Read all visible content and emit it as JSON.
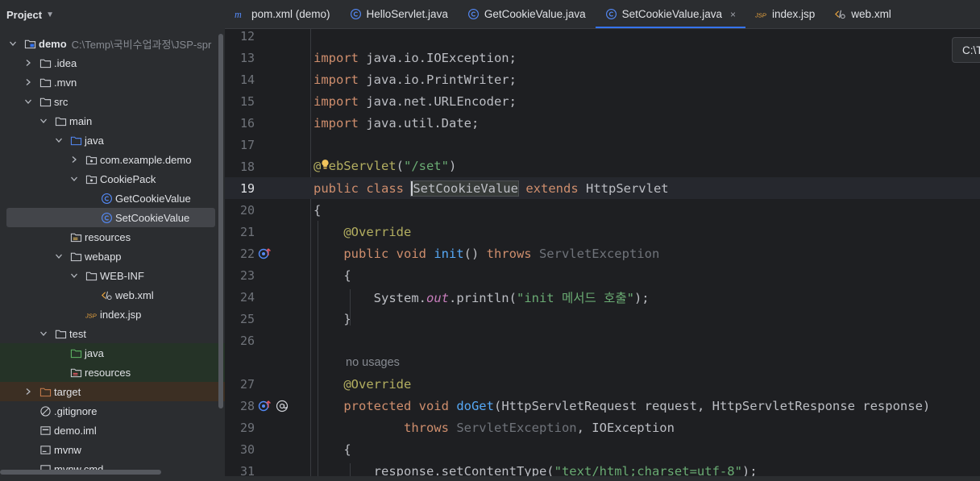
{
  "project_panel": {
    "title": "Project",
    "tree": [
      {
        "label": "demo",
        "hint": "C:\\Temp\\국비수업과정\\JSP-spr",
        "depth": 0,
        "expanded": true,
        "icon": "module-folder-icon",
        "bold": true
      },
      {
        "label": ".idea",
        "depth": 1,
        "expanded": false,
        "icon": "folder-icon"
      },
      {
        "label": ".mvn",
        "depth": 1,
        "expanded": false,
        "icon": "folder-icon"
      },
      {
        "label": "src",
        "depth": 1,
        "expanded": true,
        "icon": "folder-icon"
      },
      {
        "label": "main",
        "depth": 2,
        "expanded": true,
        "icon": "folder-icon"
      },
      {
        "label": "java",
        "depth": 3,
        "expanded": true,
        "icon": "source-folder-icon"
      },
      {
        "label": "com.example.demo",
        "depth": 4,
        "expanded": false,
        "icon": "package-icon"
      },
      {
        "label": "CookiePack",
        "depth": 4,
        "expanded": true,
        "icon": "package-icon"
      },
      {
        "label": "GetCookieValue",
        "depth": 5,
        "icon": "class-icon"
      },
      {
        "label": "SetCookieValue",
        "depth": 5,
        "icon": "class-icon",
        "selected": true
      },
      {
        "label": "resources",
        "depth": 3,
        "icon": "resources-folder-icon"
      },
      {
        "label": "webapp",
        "depth": 3,
        "expanded": true,
        "icon": "folder-icon"
      },
      {
        "label": "WEB-INF",
        "depth": 4,
        "expanded": true,
        "icon": "folder-icon"
      },
      {
        "label": "web.xml",
        "depth": 5,
        "icon": "xml-file-icon"
      },
      {
        "label": "index.jsp",
        "depth": 4,
        "icon": "jsp-file-icon"
      },
      {
        "label": "test",
        "depth": 2,
        "expanded": true,
        "icon": "folder-icon"
      },
      {
        "label": "java",
        "depth": 3,
        "icon": "test-folder-icon",
        "variant": "test"
      },
      {
        "label": "resources",
        "depth": 3,
        "icon": "test-resources-folder-icon",
        "variant": "test"
      },
      {
        "label": "target",
        "depth": 1,
        "expanded": false,
        "icon": "excluded-folder-icon",
        "variant": "excluded"
      },
      {
        "label": ".gitignore",
        "depth": 1,
        "icon": "gitignore-file-icon"
      },
      {
        "label": "demo.iml",
        "depth": 1,
        "icon": "iml-file-icon"
      },
      {
        "label": "mvnw",
        "depth": 1,
        "icon": "script-file-icon"
      },
      {
        "label": "mvnw.cmd",
        "depth": 1,
        "icon": "script-file-icon"
      }
    ]
  },
  "tabs": [
    {
      "label": "pom.xml (demo)",
      "icon": "maven-icon"
    },
    {
      "label": "HelloServlet.java",
      "icon": "class-icon"
    },
    {
      "label": "GetCookieValue.java",
      "icon": "class-icon"
    },
    {
      "label": "SetCookieValue.java",
      "icon": "class-icon",
      "active": true,
      "close": "×"
    },
    {
      "label": "index.jsp",
      "icon": "jsp-file-icon"
    },
    {
      "label": "web.xml",
      "icon": "xml-file-icon"
    }
  ],
  "tooltip": "C:\\T",
  "editor": {
    "lines": [
      {
        "n": "12",
        "tokens": []
      },
      {
        "n": "13",
        "tokens": [
          [
            "kw",
            "import"
          ],
          [
            "t",
            " java.io.IOException;"
          ]
        ]
      },
      {
        "n": "14",
        "tokens": [
          [
            "kw",
            "import"
          ],
          [
            "t",
            " java.io.PrintWriter;"
          ]
        ]
      },
      {
        "n": "15",
        "tokens": [
          [
            "kw",
            "import"
          ],
          [
            "t",
            " java.net.URLEncoder;"
          ]
        ]
      },
      {
        "n": "16",
        "tokens": [
          [
            "kw",
            "import"
          ],
          [
            "t",
            " java.util.Date;"
          ]
        ]
      },
      {
        "n": "17",
        "tokens": []
      },
      {
        "n": "18",
        "tokens": [
          [
            "ann",
            "@"
          ],
          [
            "bulb",
            ""
          ],
          [
            "ann",
            "ebServlet"
          ],
          [
            "t",
            "("
          ],
          [
            "str",
            "\"/set\""
          ],
          [
            "t",
            ")"
          ]
        ]
      },
      {
        "n": "19",
        "current": true,
        "tokens": [
          [
            "kw",
            "public class "
          ],
          [
            "hl",
            "SetCookieValue"
          ],
          [
            "t",
            " "
          ],
          [
            "kw",
            "extends"
          ],
          [
            "t",
            " HttpServlet"
          ]
        ]
      },
      {
        "n": "20",
        "tokens": [
          [
            "t",
            "{"
          ]
        ]
      },
      {
        "n": "21",
        "tokens": [
          [
            "t",
            "    "
          ],
          [
            "ann",
            "@Override"
          ]
        ]
      },
      {
        "n": "22",
        "gutter": [
          "override-icon"
        ],
        "tokens": [
          [
            "t",
            "    "
          ],
          [
            "kw",
            "public void "
          ],
          [
            "fn",
            "init"
          ],
          [
            "t",
            "() "
          ],
          [
            "kw",
            "throws "
          ],
          [
            "gray",
            "ServletException"
          ]
        ]
      },
      {
        "n": "23",
        "tokens": [
          [
            "t",
            "    {"
          ]
        ]
      },
      {
        "n": "24",
        "tokens": [
          [
            "t",
            "        System."
          ],
          [
            "ital",
            "out"
          ],
          [
            "t",
            ".println("
          ],
          [
            "str",
            "\"init 메서드 호출\""
          ],
          [
            "t",
            ");"
          ]
        ]
      },
      {
        "n": "25",
        "tokens": [
          [
            "t",
            "    }"
          ]
        ]
      },
      {
        "n": "26",
        "tokens": []
      },
      {
        "n": "",
        "hint": "no usages",
        "tokens": []
      },
      {
        "n": "27",
        "tokens": [
          [
            "t",
            "    "
          ],
          [
            "ann",
            "@Override"
          ]
        ]
      },
      {
        "n": "28",
        "gutter": [
          "override-icon",
          "at-icon"
        ],
        "tokens": [
          [
            "t",
            "    "
          ],
          [
            "kw",
            "protected void "
          ],
          [
            "fn",
            "doGet"
          ],
          [
            "t",
            "(HttpServletRequest request, HttpServletResponse response)"
          ]
        ]
      },
      {
        "n": "29",
        "tokens": [
          [
            "t",
            "            "
          ],
          [
            "kw",
            "throws "
          ],
          [
            "gray",
            "ServletException"
          ],
          [
            "t",
            ", IOException"
          ]
        ]
      },
      {
        "n": "30",
        "tokens": [
          [
            "t",
            "    {"
          ]
        ]
      },
      {
        "n": "31",
        "tokens": [
          [
            "t",
            "        response.setContentType("
          ],
          [
            "str",
            "\"text/html;charset=utf-8\""
          ],
          [
            "t",
            ");"
          ]
        ]
      }
    ]
  }
}
